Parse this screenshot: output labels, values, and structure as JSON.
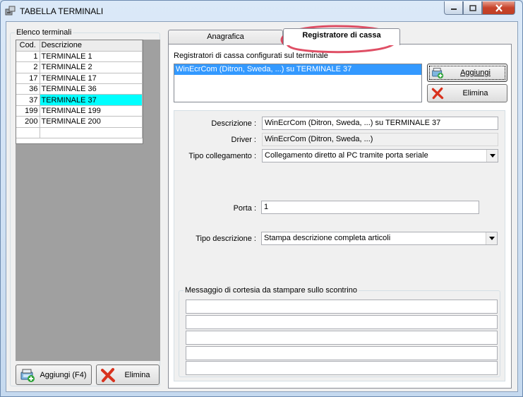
{
  "window": {
    "title": "TABELLA TERMINALI"
  },
  "terminals": {
    "group_label": "Elenco terminali",
    "columns": [
      "Cod.",
      "Descrizione"
    ],
    "rows": [
      {
        "cod": "1",
        "desc": "TERMINALE 1"
      },
      {
        "cod": "2",
        "desc": "TERMINALE 2"
      },
      {
        "cod": "17",
        "desc": "TERMINALE 17"
      },
      {
        "cod": "36",
        "desc": "TERMINALE 36"
      },
      {
        "cod": "37",
        "desc": "TERMINALE 37"
      },
      {
        "cod": "199",
        "desc": "TERMINALE 199"
      },
      {
        "cod": "200",
        "desc": "TERMINALE 200"
      }
    ],
    "selected_cod": "37",
    "add_button": "Aggiungi (F4)",
    "delete_button": "Elimina"
  },
  "tabs": [
    {
      "label": "Anagrafica",
      "active": false
    },
    {
      "label": "Registratore di cassa",
      "active": true
    }
  ],
  "registers": {
    "list_label": "Registratori di cassa configurati sul terminale",
    "items": [
      "WinEcrCom (Ditron, Sweda, ...) su TERMINALE 37"
    ],
    "add_button": "Aggiungi",
    "delete_button": "Elimina"
  },
  "form": {
    "descrizione_label": "Descrizione :",
    "descrizione_value": "WinEcrCom (Ditron, Sweda, ...) su TERMINALE 37",
    "driver_label": "Driver :",
    "driver_value": "WinEcrCom (Ditron, Sweda, ...)",
    "tipo_collegamento_label": "Tipo collegamento :",
    "tipo_collegamento_value": "Collegamento diretto al PC tramite porta seriale",
    "porta_label": "Porta :",
    "porta_value": "1",
    "tipo_descrizione_label": "Tipo descrizione :",
    "tipo_descrizione_value": "Stampa descrizione completa articoli",
    "messaggio_label": "Messaggio di cortesia da stampare sullo scontrino"
  },
  "colors": {
    "selected_row": "#00ffff",
    "list_selection": "#3399ff",
    "annotation": "#d9304a"
  }
}
